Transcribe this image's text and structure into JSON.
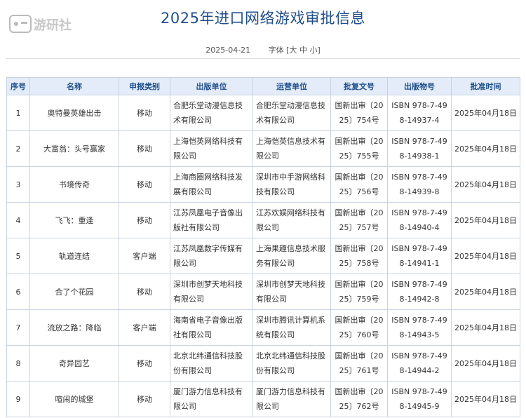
{
  "page": {
    "title": "2025年进口网络游戏审批信息",
    "date": "2025-04-21",
    "font_size_label": "字体",
    "font_size_options": "[大 中 小]",
    "logo_text": "游研社",
    "accent_color": "#1f4e8c",
    "header_bg": "#e3ecf8"
  },
  "table": {
    "headers": [
      "序号",
      "名称",
      "申报类别",
      "出版单位",
      "运营单位",
      "批复文号",
      "出版物号",
      "批准时间"
    ],
    "rows": [
      [
        "1",
        "奥特曼英雄出击",
        "移动",
        "合肥乐堂动漫信息技术有限公司",
        "合肥乐堂动漫信息技术有限公司",
        "国新出审〔2025〕754号",
        "ISBN 978-7-498-14937-4",
        "2025年04月18日"
      ],
      [
        "2",
        "大富翁：头号赢家",
        "移动",
        "上海恺英网络科技有限公司",
        "上海恺英信息技术有限公司",
        "国新出审〔2025〕755号",
        "ISBN 978-7-498-14938-1",
        "2025年04月18日"
      ],
      [
        "3",
        "书境传奇",
        "移动",
        "上海商圈网络科技发展有限公司",
        "深圳市中手游网络科技有限公司",
        "国新出审〔2025〕756号",
        "ISBN 978-7-498-14939-8",
        "2025年04月18日"
      ],
      [
        "4",
        "飞飞：重逢",
        "移动",
        "江苏凤凰电子音像出版社有限公司",
        "江苏欢娱网络科技有限公司",
        "国新出审〔2025〕757号",
        "ISBN 978-7-498-14940-4",
        "2025年04月18日"
      ],
      [
        "5",
        "轨道连结",
        "客户端",
        "江苏凤凰数字传媒有限公司",
        "上海果趣信息技术服务有限公司",
        "国新出审〔2025〕758号",
        "ISBN 978-7-498-14941-1",
        "2025年04月18日"
      ],
      [
        "6",
        "合了个花园",
        "移动",
        "深圳市创梦天地科技有限公司",
        "深圳市创梦天地科技有限公司",
        "国新出审〔2025〕759号",
        "ISBN 978-7-498-14942-8",
        "2025年04月18日"
      ],
      [
        "7",
        "流放之路：降临",
        "客户端",
        "海南省电子音像出版社有限公司",
        "深圳市腾讯计算机系统有限公司",
        "国新出审〔2025〕760号",
        "ISBN 978-7-498-14943-5",
        "2025年04月18日"
      ],
      [
        "8",
        "奇异园艺",
        "移动",
        "北京北纬通信科技股份有限公司",
        "北京北纬通信科技股份有限公司",
        "国新出审〔2025〕761号",
        "ISBN 978-7-498-14944-2",
        "2025年04月18日"
      ],
      [
        "9",
        "喧闹的城堡",
        "移动",
        "厦门游力信息科技有限公司",
        "厦门游力信息科技有限公司",
        "国新出审〔2025〕762号",
        "ISBN 978-7-498-14945-9",
        "2025年04月18日"
      ]
    ]
  }
}
